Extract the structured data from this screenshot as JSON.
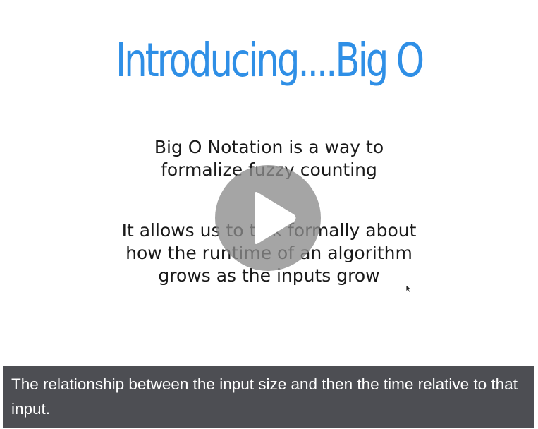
{
  "slide": {
    "title": "Introducing....Big O",
    "paragraph_1": {
      "lines": [
        "Big O Notation is a way to",
        "formalize fuzzy counting"
      ]
    },
    "paragraph_2": {
      "lines": [
        "It allows us to talk formally about",
        "how the runtime of an algorithm",
        "grows as the inputs grow"
      ]
    }
  },
  "player": {
    "play_icon": "play-icon",
    "cursor_icon": "mouse-pointer-icon"
  },
  "caption": {
    "text": "The relationship between the input size and then the time relative to that input."
  },
  "colors": {
    "title": "#2f8fe6",
    "body_text": "#1a1a1a",
    "caption_bg": "#4d4e53",
    "caption_text": "#ffffff",
    "play_overlay": "#8c8c8c"
  }
}
